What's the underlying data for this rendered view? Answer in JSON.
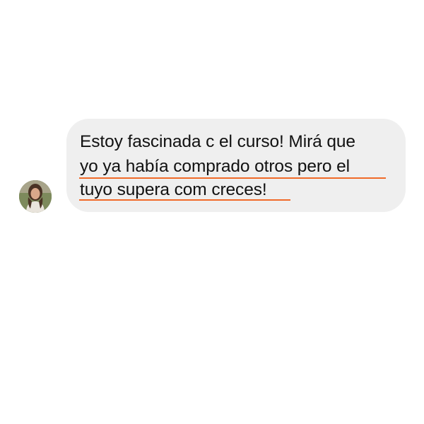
{
  "message": {
    "lines": [
      "Estoy fascinada c el curso! Mirá que",
      "yo ya había comprado otros pero el",
      "tuyo supera com creces!"
    ]
  },
  "colors": {
    "bubble_background": "#efefef",
    "underline": "#f06a28",
    "text": "#111111",
    "page_background": "#ffffff"
  },
  "icons": {
    "avatar": "user-avatar-photo"
  }
}
